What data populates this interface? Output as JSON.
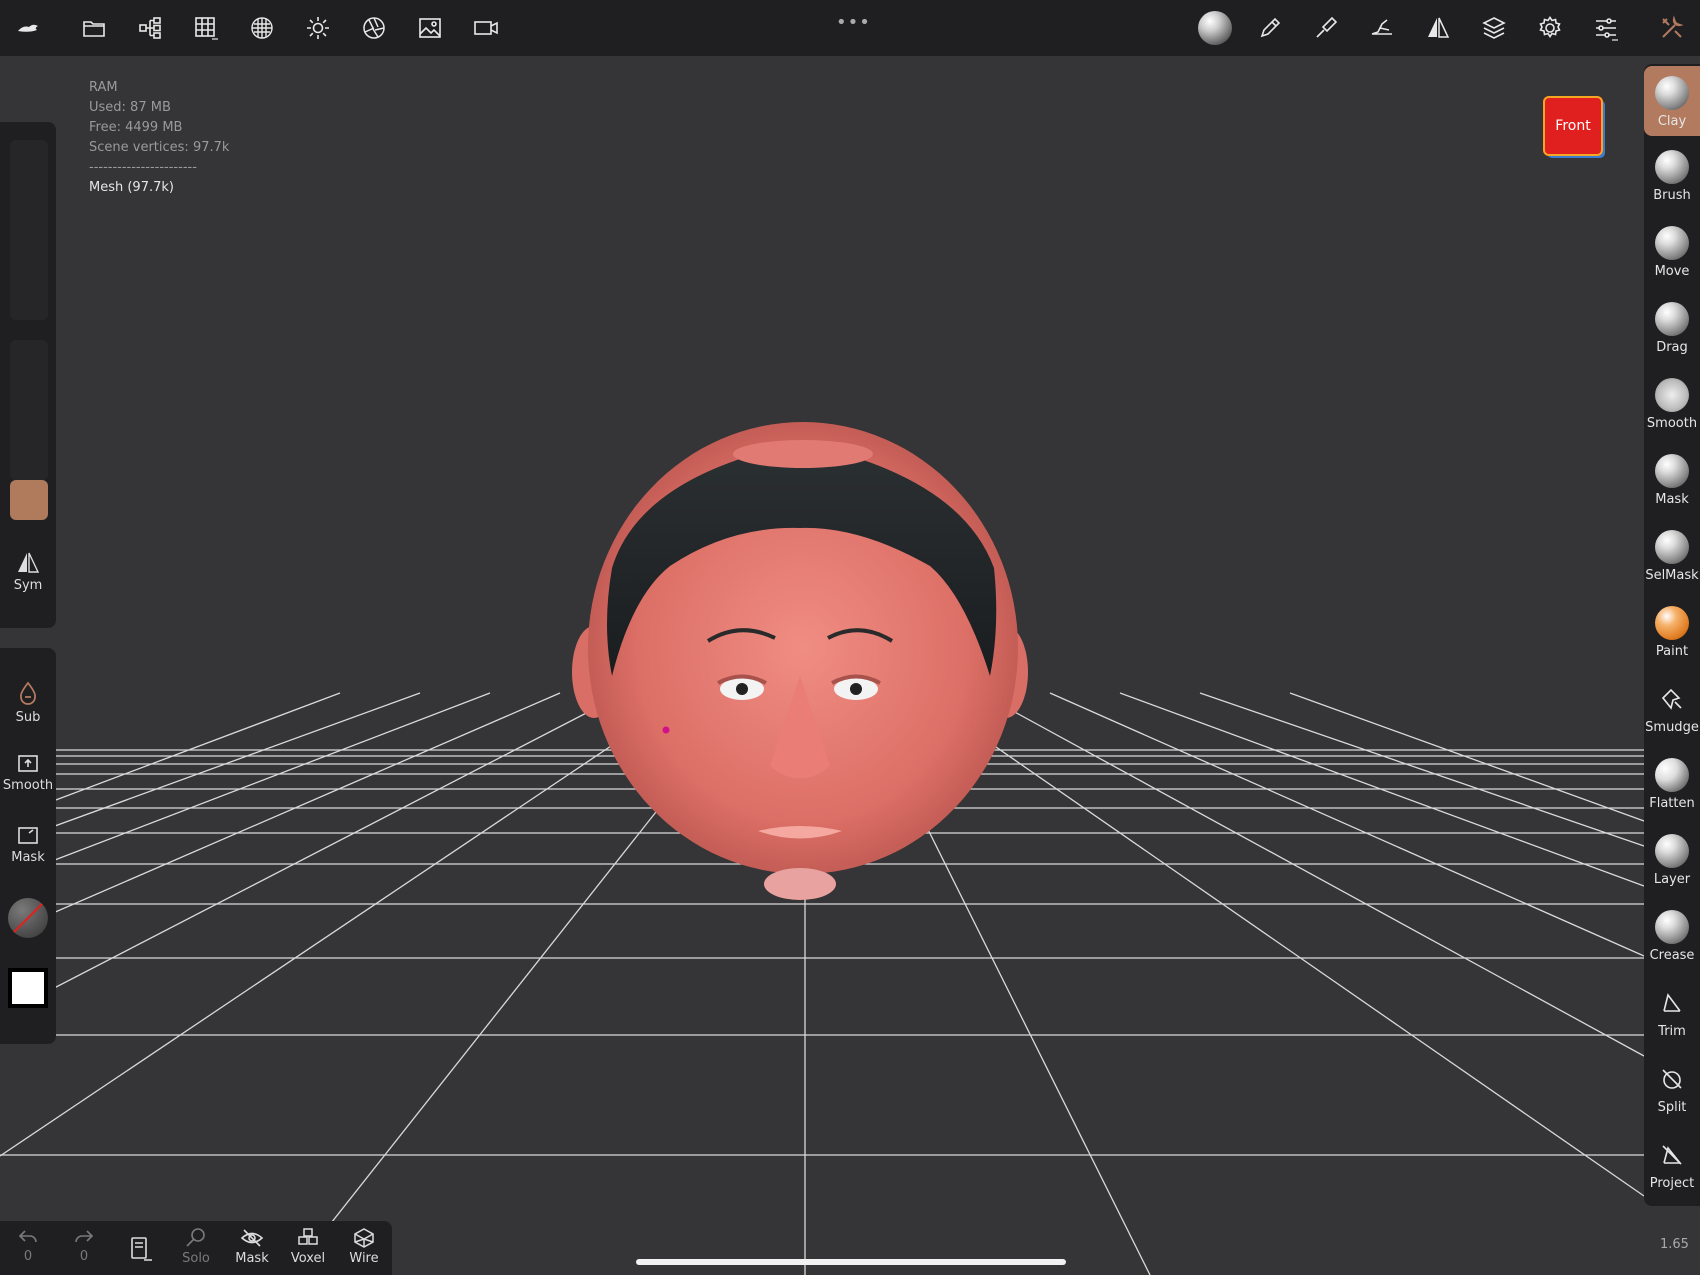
{
  "stats": {
    "ram_label": "RAM",
    "used": "Used: 87 MB",
    "free": "Free: 4499 MB",
    "scene_vertices": "Scene vertices: 97.7k",
    "separator": "-----------------------",
    "mesh": "Mesh (97.7k)"
  },
  "view": {
    "front_label": "Front",
    "zoom": "1.65"
  },
  "top_left_icons": [
    "app-logo-icon",
    "folder-icon",
    "scene-tree-icon",
    "grid-topology-icon",
    "sphere-material-icon",
    "sun-icon",
    "aperture-icon",
    "image-icon",
    "video-camera-icon"
  ],
  "top_right_icons": [
    "matcap-ball-icon",
    "stroke-pen-icon",
    "brush-settings-icon",
    "hand-pose-icon",
    "symmetry-icon",
    "layers-icon",
    "gear-icon",
    "sliders-icon",
    "tools-icon"
  ],
  "left_panel": {
    "sym_label": "Sym",
    "sub_label": "Sub",
    "smooth_label": "Smooth",
    "mask_label": "Mask",
    "color_swatch": "#b07a5c"
  },
  "tools": [
    {
      "id": "clay",
      "label": "Clay",
      "active": true
    },
    {
      "id": "brush",
      "label": "Brush"
    },
    {
      "id": "move",
      "label": "Move"
    },
    {
      "id": "drag",
      "label": "Drag"
    },
    {
      "id": "smooth",
      "label": "Smooth"
    },
    {
      "id": "mask",
      "label": "Mask"
    },
    {
      "id": "selmask",
      "label": "SelMask"
    },
    {
      "id": "paint",
      "label": "Paint"
    },
    {
      "id": "smudge",
      "label": "Smudge"
    },
    {
      "id": "flatten",
      "label": "Flatten"
    },
    {
      "id": "layer",
      "label": "Layer"
    },
    {
      "id": "crease",
      "label": "Crease"
    },
    {
      "id": "trim",
      "label": "Trim"
    },
    {
      "id": "split",
      "label": "Split"
    },
    {
      "id": "project",
      "label": "Project"
    }
  ],
  "bottom": {
    "undo_count": "0",
    "redo_count": "0",
    "solo_label": "Solo",
    "mask_label": "Mask",
    "voxel_label": "Voxel",
    "wire_label": "Wire"
  },
  "colors": {
    "accent": "#b27a5f",
    "panel": "#1f1f21",
    "viewport": "#353436",
    "front_button": "#e0201e"
  }
}
